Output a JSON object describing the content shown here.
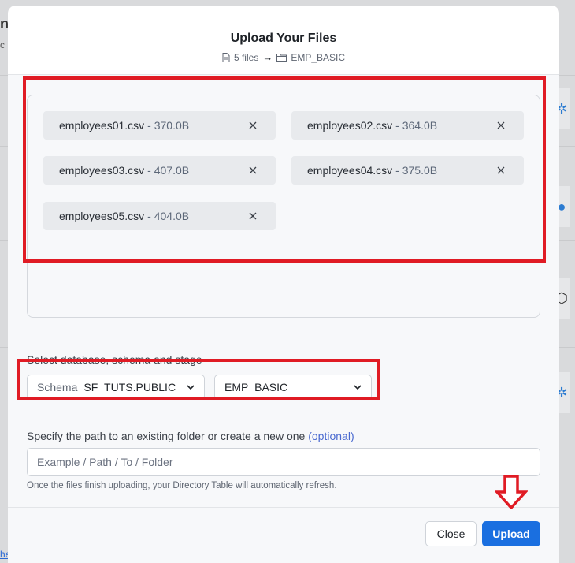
{
  "background": {
    "title_fragment": "nt",
    "subtitle_fragment": "c",
    "link_fragment": "he"
  },
  "modal": {
    "title": "Upload Your Files",
    "subtitle": {
      "file_icon": "file-icon",
      "count": "5 files",
      "arrow": "→",
      "folder_icon": "folder-icon",
      "stage": "EMP_BASIC"
    }
  },
  "files": [
    {
      "name": "employees01.csv",
      "size": "- 370.0B"
    },
    {
      "name": "employees02.csv",
      "size": "- 364.0B"
    },
    {
      "name": "employees03.csv",
      "size": "- 407.0B"
    },
    {
      "name": "employees04.csv",
      "size": "- 375.0B"
    },
    {
      "name": "employees05.csv",
      "size": "- 404.0B"
    }
  ],
  "target": {
    "label": "Select database, schema and stage",
    "schema_prefix": "Schema",
    "schema_value": "SF_TUTS.PUBLIC",
    "stage_value": "EMP_BASIC"
  },
  "path": {
    "label": "Specify the path to an existing folder or create a new one",
    "optional": "(optional)",
    "placeholder": "Example / Path / To / Folder",
    "help": "Once the files finish uploading, your Directory Table will automatically refresh."
  },
  "footer": {
    "close_label": "Close",
    "upload_label": "Upload"
  },
  "colors": {
    "primary": "#1a6fe0",
    "annotation_red": "#e01b24"
  }
}
